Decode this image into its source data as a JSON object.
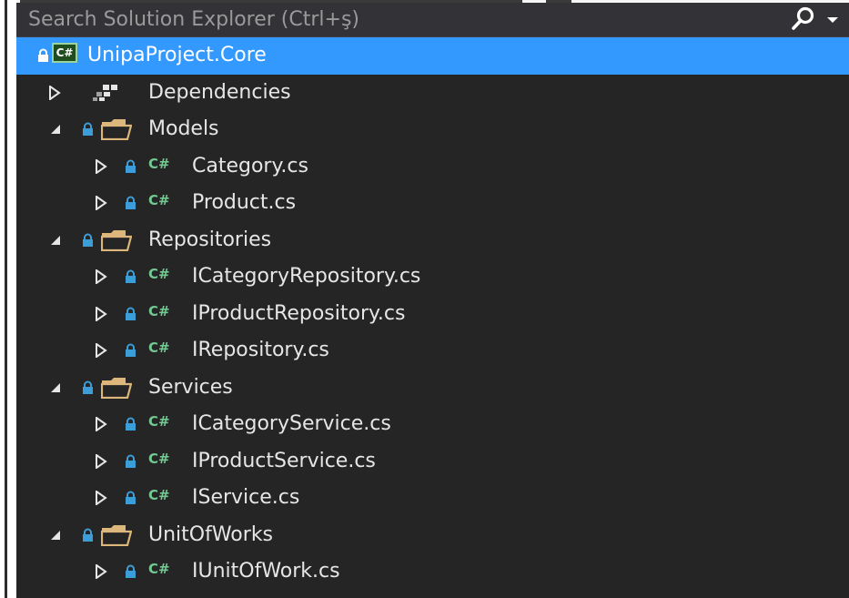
{
  "search": {
    "placeholder": "Search Solution Explorer (Ctrl+ş)"
  },
  "colors": {
    "selection": "#3399ff",
    "panel_bg": "#252526",
    "cs_green": "#73c991",
    "lock_blue": "#3b9ed8",
    "folder": "#dcb67a"
  },
  "project": {
    "name": "UnipaProject.Core",
    "badge": "C#"
  },
  "cs_badge": "C#",
  "dependencies": {
    "label": "Dependencies"
  },
  "folders": [
    {
      "name": "Models",
      "files": [
        "Category.cs",
        "Product.cs"
      ]
    },
    {
      "name": "Repositories",
      "files": [
        "ICategoryRepository.cs",
        "IProductRepository.cs",
        "IRepository.cs"
      ]
    },
    {
      "name": "Services",
      "files": [
        "ICategoryService.cs",
        "IProductService.cs",
        "IService.cs"
      ]
    },
    {
      "name": "UnitOfWorks",
      "files": [
        "IUnitOfWork.cs"
      ]
    }
  ]
}
